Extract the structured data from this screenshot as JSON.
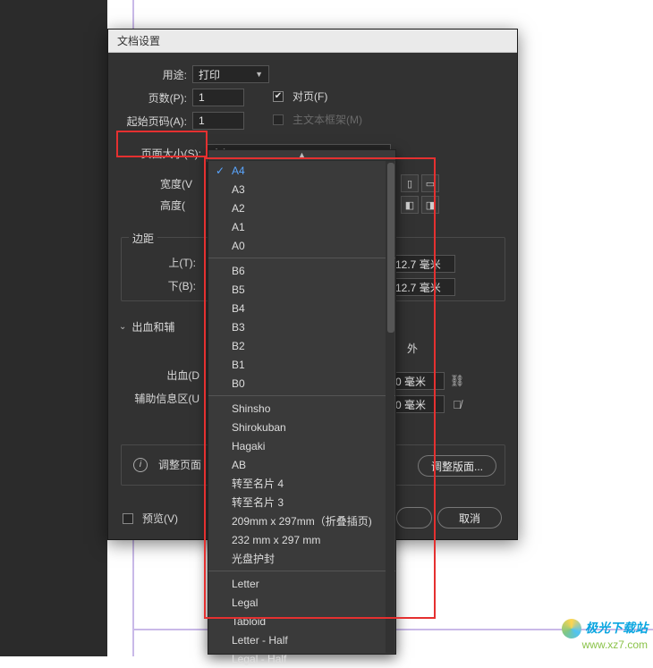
{
  "dialog": {
    "title": "文档设置",
    "intent_label": "用途:",
    "intent_value": "打印",
    "pages_label": "页数(P):",
    "pages_value": "1",
    "facing_label": "对页(F)",
    "facing_checked": true,
    "startpage_label": "起始页码(A):",
    "startpage_value": "1",
    "primaryframe_label": "主文本框架(M)",
    "primaryframe_checked": false,
    "pagesize_label": "页面大小(S):",
    "pagesize_value": "A4",
    "width_label": "宽度(V",
    "height_label": "高度(",
    "margins_title": "边距",
    "margin_top_label": "上(T):",
    "margin_bottom_label": "下(B):",
    "margin_val_right": "12.7 毫米",
    "bleed_title": "出血和辅",
    "outer_label": "外",
    "bleed_label": "出血(D",
    "slug_label": "辅助信息区(U",
    "zero_mm": "0 毫米",
    "adjust_page_label": "调整页面",
    "adjust_layout_btn": "调整版面...",
    "preview_label": "预览(V)",
    "cancel_btn": "取消"
  },
  "dropdown": {
    "items_a": [
      "A4",
      "A3",
      "A2",
      "A1",
      "A0"
    ],
    "items_b": [
      "B6",
      "B5",
      "B4",
      "B3",
      "B2",
      "B1",
      "B0"
    ],
    "items_c": [
      "Shinsho",
      "Shirokuban",
      "Hagaki",
      "AB",
      "转至名片 4",
      "转至名片 3",
      "209mm x 297mm（折叠插页)",
      "232 mm x 297 mm",
      "光盘护封"
    ],
    "items_d": [
      "Letter",
      "Legal",
      "Tabloid",
      "Letter - Half",
      "Legal - Half"
    ],
    "selected": "A4"
  },
  "watermark": {
    "line1": "极光下载站",
    "line2": "www.xz7.com"
  }
}
